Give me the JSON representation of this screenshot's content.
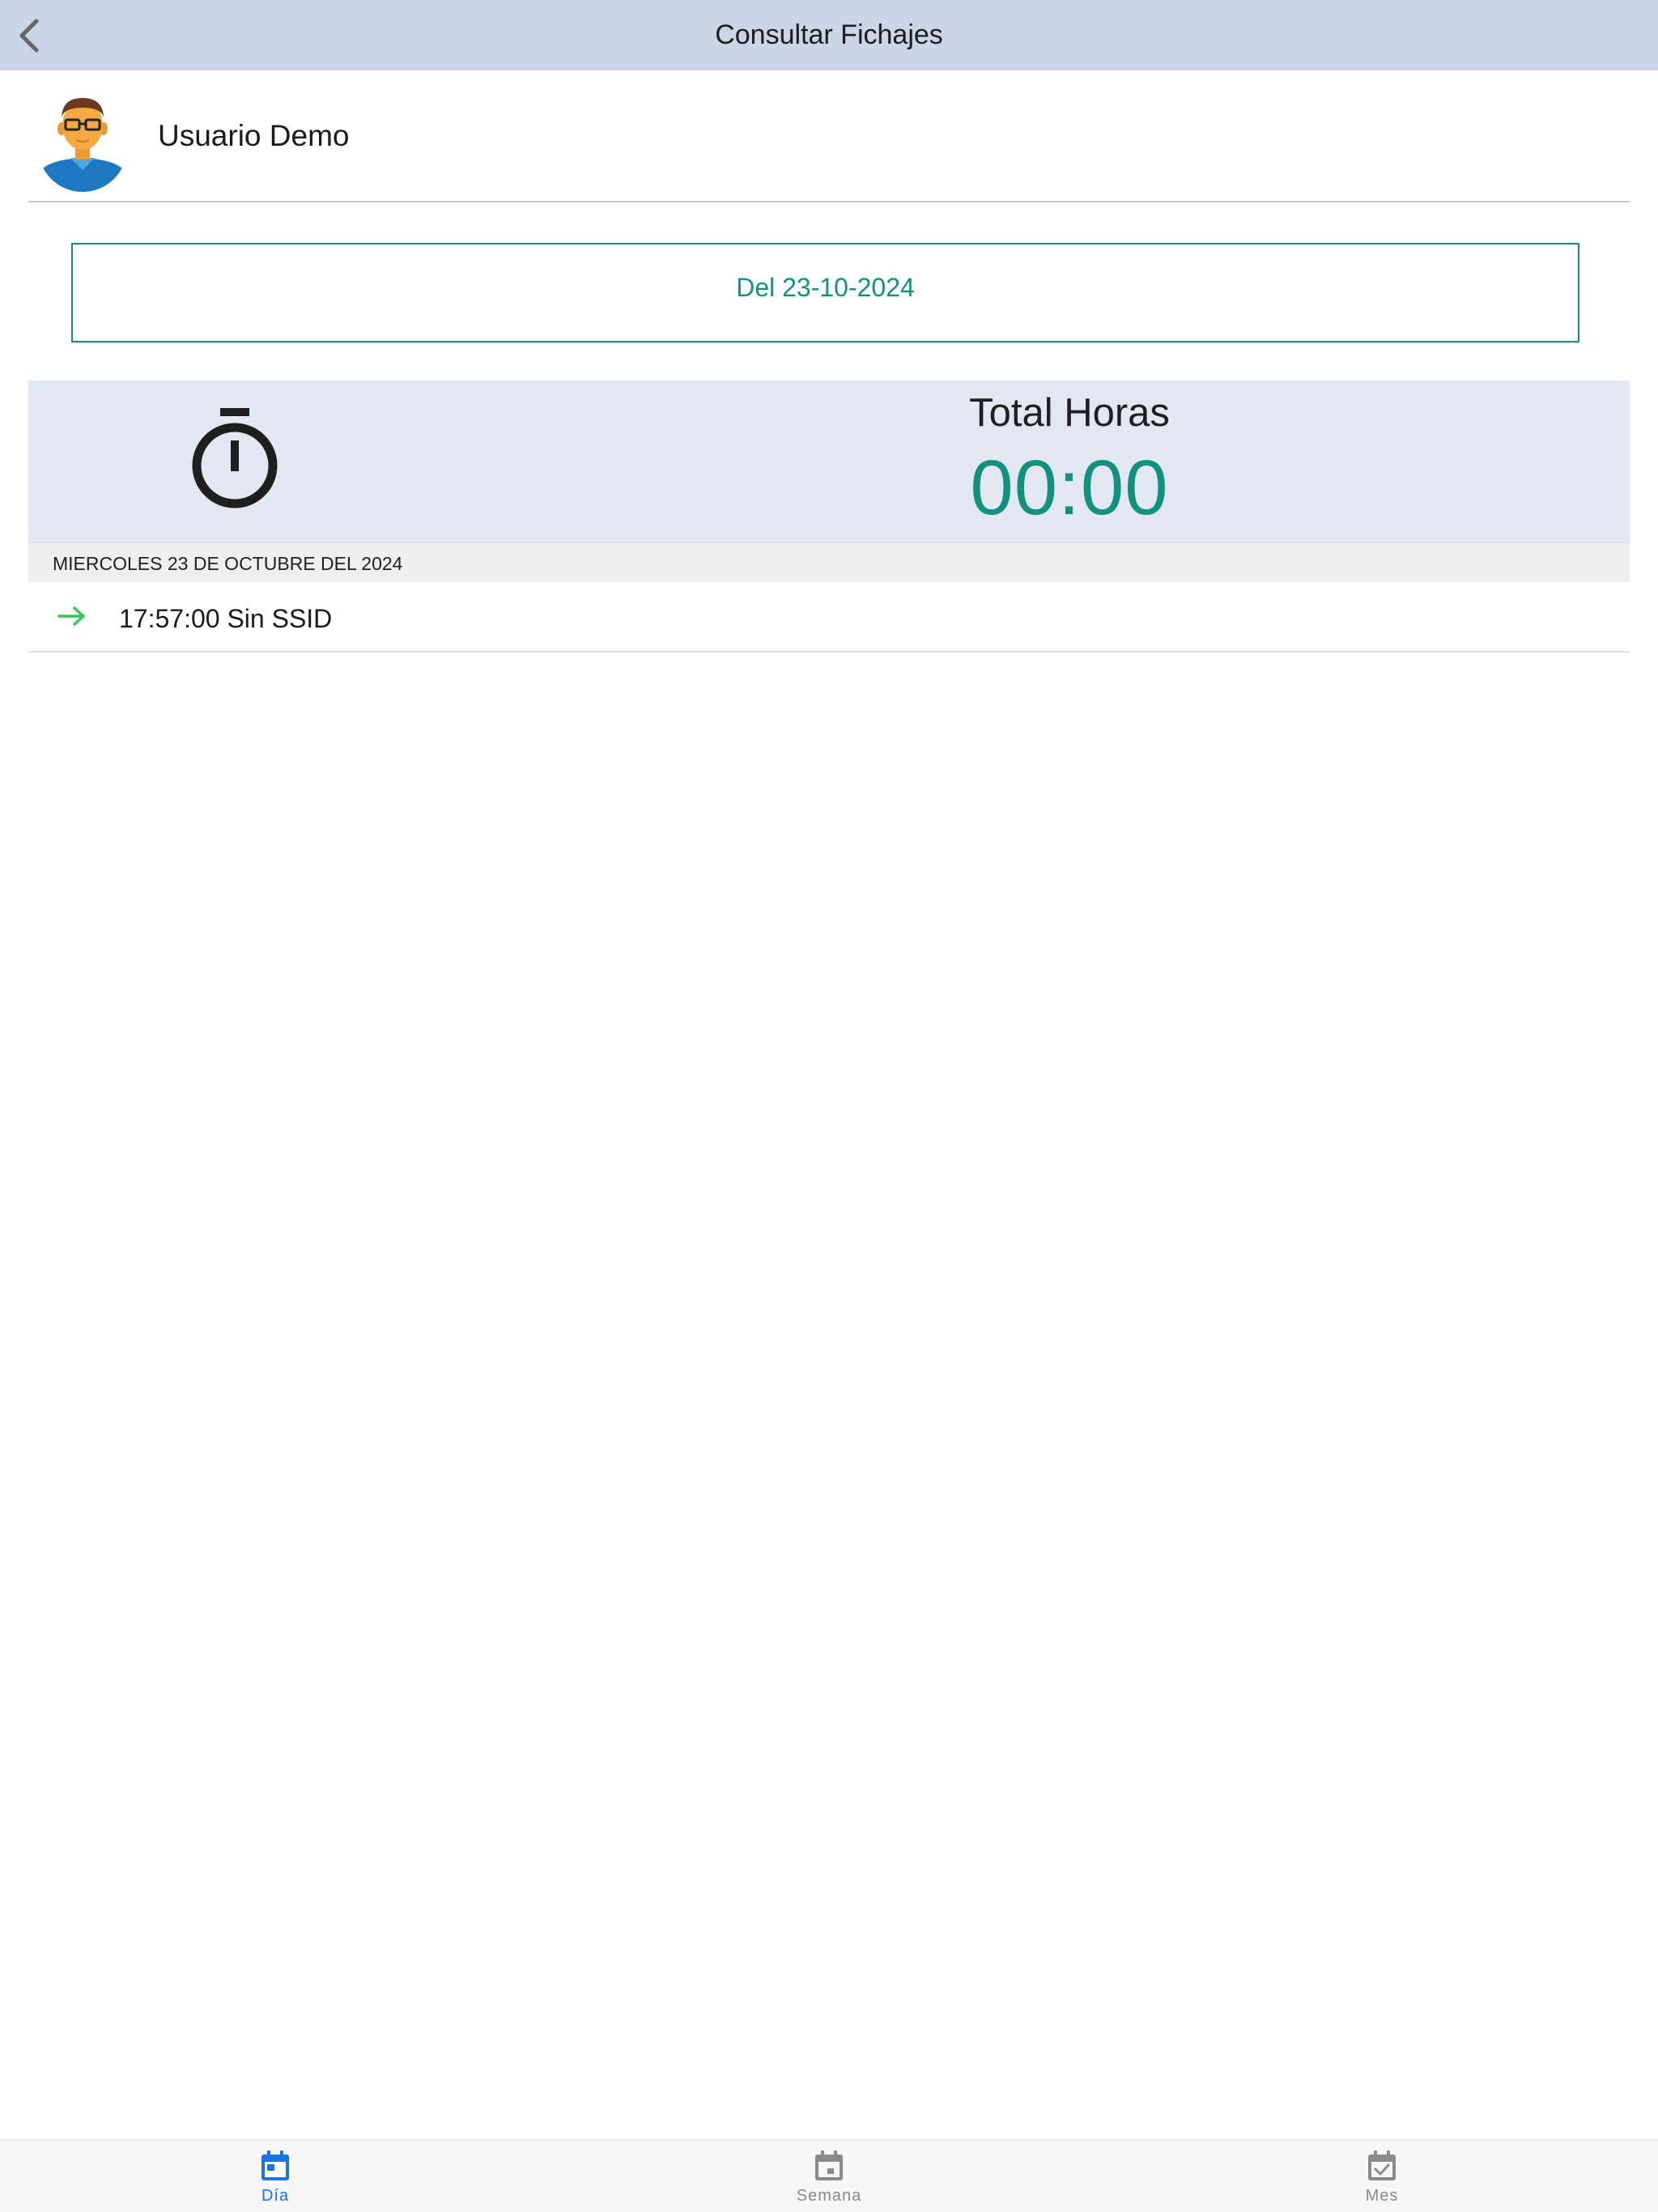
{
  "header": {
    "title": "Consultar Fichajes",
    "back_icon": "chevron-left-icon"
  },
  "user": {
    "name": "Usuario Demo",
    "avatar_icon": "user-avatar-icon"
  },
  "date_selector": {
    "label": "Del 23-10-2024"
  },
  "totals": {
    "label": "Total Horas",
    "value": "00:00",
    "icon": "stopwatch-icon"
  },
  "day_section": {
    "header": "MIERCOLES 23 DE OCTUBRE DEL 2024",
    "entries": [
      {
        "text": "17:57:00 Sin SSID",
        "icon": "arrow-right-icon"
      }
    ]
  },
  "tabs": [
    {
      "label": "Día",
      "icon": "calendar-day-icon",
      "active": true
    },
    {
      "label": "Semana",
      "icon": "calendar-week-icon",
      "active": false
    },
    {
      "label": "Mes",
      "icon": "calendar-check-icon",
      "active": false
    }
  ],
  "colors": {
    "header_bg": "#cbd5e6",
    "accent": "#12917e",
    "panel_bg": "#e2e7f1",
    "tab_active": "#1a73e8",
    "tab_inactive": "#8a8a8a",
    "entry_arrow": "#34c759"
  }
}
